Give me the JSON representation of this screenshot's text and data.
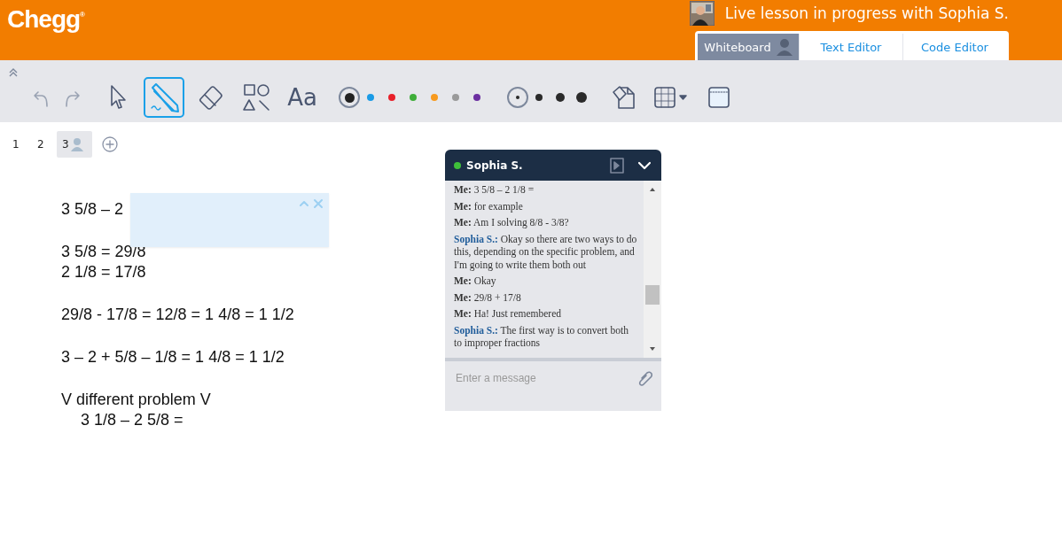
{
  "header": {
    "logo": "Chegg",
    "logo_mark": "®",
    "status": "Live lesson in progress with Sophia S."
  },
  "mode_tabs": [
    {
      "label": "Whiteboard",
      "selected": true
    },
    {
      "label": "Text Editor",
      "selected": false
    },
    {
      "label": "Code Editor",
      "selected": false
    }
  ],
  "tools": [
    {
      "kind": "undo",
      "selected": false
    },
    {
      "kind": "redo",
      "selected": false
    },
    {
      "kind": "select",
      "selected": false
    },
    {
      "kind": "pen",
      "selected": true
    },
    {
      "kind": "eraser",
      "selected": false
    },
    {
      "kind": "shapes",
      "selected": false
    },
    {
      "kind": "text",
      "label": "Aa",
      "selected": false
    }
  ],
  "colors": [
    {
      "color": "#222222",
      "selected": true
    },
    {
      "color": "#1a9be6",
      "selected": false
    },
    {
      "color": "#e8202a",
      "selected": false
    },
    {
      "color": "#3fae3a",
      "selected": false
    },
    {
      "color": "#f79a1e",
      "selected": false
    },
    {
      "color": "#9a9a9a",
      "selected": false
    },
    {
      "color": "#6b2fa0",
      "selected": false
    }
  ],
  "sizes": [
    {
      "selected": true
    },
    {
      "selected": false
    },
    {
      "selected": false
    },
    {
      "selected": false
    }
  ],
  "pages": [
    {
      "label": "1",
      "selected": false
    },
    {
      "label": "2",
      "selected": false
    },
    {
      "label": "3",
      "selected": true
    }
  ],
  "whiteboard": [
    [
      {
        "text": "3 5/8 – 2",
        "indented": false
      }
    ],
    [
      {
        "text": "3 5/8 = 29/8",
        "indented": false
      },
      {
        "text": "2 1/8 = 17/8",
        "indented": false
      }
    ],
    [
      {
        "text": "29/8 - 17/8 = 12/8 = 1 4/8 = 1 1/2",
        "indented": false
      }
    ],
    [
      {
        "text": "3 – 2 + 5/8 – 1/8 = 1 4/8 = 1 1/2",
        "indented": false
      }
    ],
    [
      {
        "text": "V different problem V",
        "indented": false
      },
      {
        "text": "3 1/8 – 2 5/8 =",
        "indented": true
      }
    ]
  ],
  "chat": {
    "name": "Sophia S.",
    "online": true,
    "messages": [
      {
        "sender": "Me:",
        "text": "3 5/8 – 2 1/8 =",
        "kind": "me"
      },
      {
        "sender": "Me:",
        "text": "for example",
        "kind": "me"
      },
      {
        "sender": "Me:",
        "text": "Am I solving 8/8 - 3/8?",
        "kind": "me"
      },
      {
        "sender": "Sophia S.:",
        "text": "Okay so there are two ways to do this, depending on the specific problem, and I'm going to write them both out",
        "kind": "tutor"
      },
      {
        "sender": "Me:",
        "text": "Okay",
        "kind": "me"
      },
      {
        "sender": "Me:",
        "text": "29/8 + 17/8",
        "kind": "me"
      },
      {
        "sender": "Me:",
        "text": "Ha! Just remembered",
        "kind": "me"
      },
      {
        "sender": "Sophia S.:",
        "text": "The first way is to convert both to improper fractions",
        "kind": "tutor"
      }
    ],
    "placeholder": "Enter a message"
  }
}
